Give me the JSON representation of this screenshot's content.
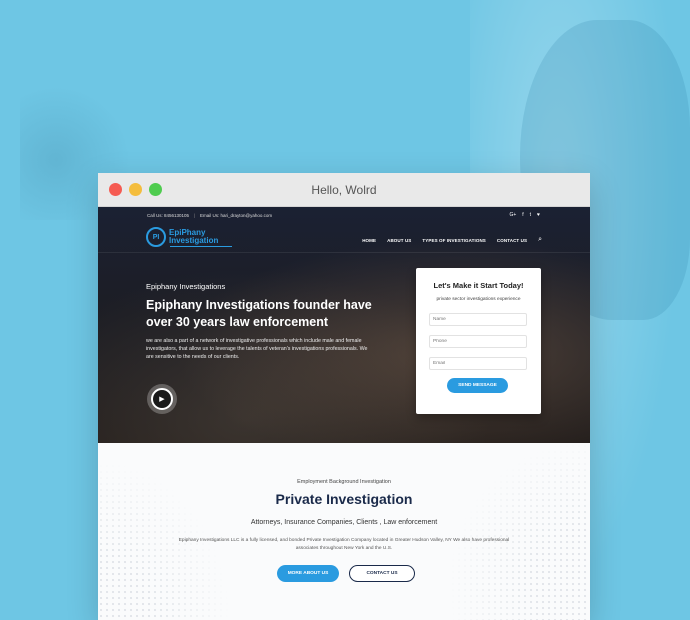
{
  "window": {
    "title": "Hello, Wolrd"
  },
  "topbar": {
    "phone": "Call Us: 8456130105",
    "separator": "|",
    "email": "Email Us: hari_drayton@yahoo.com",
    "social": [
      {
        "label": "G+",
        "icon": "google-plus-icon"
      },
      {
        "label": "f",
        "icon": "facebook-icon"
      },
      {
        "label": "t",
        "icon": "twitter-icon"
      },
      {
        "label": "♥",
        "icon": "heart-icon"
      }
    ]
  },
  "logo": {
    "mark": "PI",
    "line1": "EpiPhany",
    "line2": "Investigation"
  },
  "nav": {
    "items": [
      "HOME",
      "ABOUT US",
      "TYPES OF INVESTIGATIONS",
      "CONTACT US"
    ],
    "search_icon": "⌕"
  },
  "hero": {
    "kicker": "Epiphany Investigations",
    "title": "Epiphany Investigations founder have over 30 years law enforcement",
    "description": "we are also a part of a network of investigative professionals which include male and female investigators, that allow us to leverage the talents of veteran's investigations professionals. We are sensitive to the needs of our clients.",
    "play_icon": "▶"
  },
  "form": {
    "title": "Let's Make it Start Today!",
    "subtitle": "private sector investigations experience",
    "name_placeholder": "Name",
    "phone_placeholder": "Phone",
    "email_placeholder": "Email",
    "submit_label": "SEND MESSAGE"
  },
  "content": {
    "kicker": "Employment Background Investigation",
    "title": "Private Investigation",
    "subtitle": "Attorneys, Insurance Companies, Clients , Law enforcement",
    "description": "Epiphany Investigations LLC is a fully licensed, and bonded Private Investigation Company located in Greater Hudson Valley, NY We also have professional associates throughout New York and the U.S.",
    "more_label": "MORE ABOUT US",
    "contact_label": "CONTACT US"
  },
  "colors": {
    "background": "#6ec6e4",
    "accent": "#2a9be0",
    "navy": "#1a2a4a"
  }
}
